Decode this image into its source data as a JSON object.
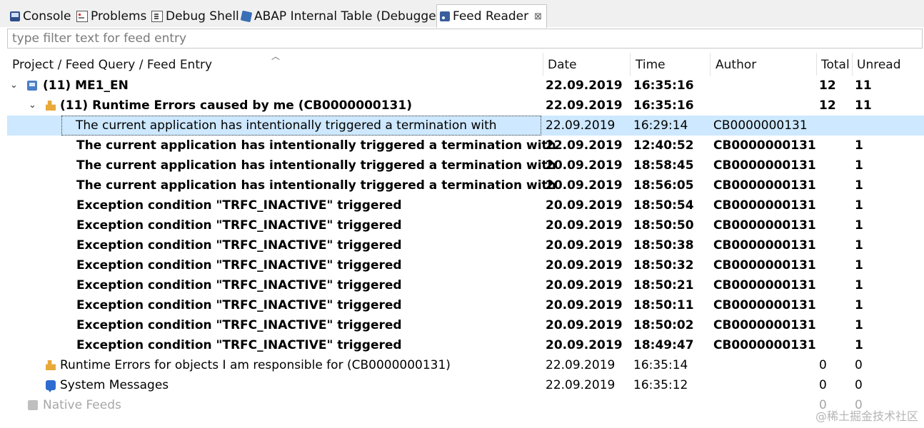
{
  "tabs": [
    {
      "label": "Console",
      "icon": "console-icon"
    },
    {
      "label": "Problems",
      "icon": "problems-icon"
    },
    {
      "label": "Debug Shell",
      "icon": "debug-shell-icon"
    },
    {
      "label": "ABAP Internal Table (Debugger)",
      "icon": "abap-table-icon"
    },
    {
      "label": "Feed Reader",
      "icon": "feed-reader-icon",
      "active": true,
      "close": "⊠"
    }
  ],
  "filter": {
    "placeholder": "type filter text for feed entry",
    "value": ""
  },
  "columns": {
    "entry": "Project / Feed Query / Feed Entry",
    "date": "Date",
    "time": "Time",
    "author": "Author",
    "total": "Total",
    "unread": "Unread"
  },
  "rows": [
    {
      "label": "(11) ME1_EN",
      "date": "22.09.2019",
      "time": "16:35:16",
      "author": "",
      "total": "12",
      "unread": "11",
      "bold": true
    },
    {
      "label": "(11) Runtime Errors caused by me (CB0000000131)",
      "date": "22.09.2019",
      "time": "16:35:16",
      "author": "",
      "total": "12",
      "unread": "11",
      "bold": true
    },
    {
      "label": "The current application has intentionally triggered a termination with",
      "date": "22.09.2019",
      "time": "16:29:14",
      "author": "CB0000000131",
      "total": "",
      "unread": "",
      "bold": false,
      "selected": true
    },
    {
      "label": "The current application has intentionally triggered a termination with",
      "date": "22.09.2019",
      "time": "12:40:52",
      "author": "CB0000000131",
      "total": "",
      "unread": "1",
      "bold": true
    },
    {
      "label": "The current application has intentionally triggered a termination with",
      "date": "20.09.2019",
      "time": "18:58:45",
      "author": "CB0000000131",
      "total": "",
      "unread": "1",
      "bold": true
    },
    {
      "label": "The current application has intentionally triggered a termination with",
      "date": "20.09.2019",
      "time": "18:56:05",
      "author": "CB0000000131",
      "total": "",
      "unread": "1",
      "bold": true
    },
    {
      "label": "Exception condition \"TRFC_INACTIVE\" triggered",
      "date": "20.09.2019",
      "time": "18:50:54",
      "author": "CB0000000131",
      "total": "",
      "unread": "1",
      "bold": true
    },
    {
      "label": "Exception condition \"TRFC_INACTIVE\" triggered",
      "date": "20.09.2019",
      "time": "18:50:50",
      "author": "CB0000000131",
      "total": "",
      "unread": "1",
      "bold": true
    },
    {
      "label": "Exception condition \"TRFC_INACTIVE\" triggered",
      "date": "20.09.2019",
      "time": "18:50:38",
      "author": "CB0000000131",
      "total": "",
      "unread": "1",
      "bold": true
    },
    {
      "label": "Exception condition \"TRFC_INACTIVE\" triggered",
      "date": "20.09.2019",
      "time": "18:50:32",
      "author": "CB0000000131",
      "total": "",
      "unread": "1",
      "bold": true
    },
    {
      "label": "Exception condition \"TRFC_INACTIVE\" triggered",
      "date": "20.09.2019",
      "time": "18:50:21",
      "author": "CB0000000131",
      "total": "",
      "unread": "1",
      "bold": true
    },
    {
      "label": "Exception condition \"TRFC_INACTIVE\" triggered",
      "date": "20.09.2019",
      "time": "18:50:11",
      "author": "CB0000000131",
      "total": "",
      "unread": "1",
      "bold": true
    },
    {
      "label": "Exception condition \"TRFC_INACTIVE\" triggered",
      "date": "20.09.2019",
      "time": "18:50:02",
      "author": "CB0000000131",
      "total": "",
      "unread": "1",
      "bold": true
    },
    {
      "label": "Exception condition \"TRFC_INACTIVE\" triggered",
      "date": "20.09.2019",
      "time": "18:49:47",
      "author": "CB0000000131",
      "total": "",
      "unread": "1",
      "bold": true
    },
    {
      "label": "Runtime Errors for objects I am responsible for (CB0000000131)",
      "date": "22.09.2019",
      "time": "16:35:14",
      "author": "",
      "total": "0",
      "unread": "0",
      "bold": false
    },
    {
      "label": "System Messages",
      "date": "22.09.2019",
      "time": "16:35:12",
      "author": "",
      "total": "0",
      "unread": "0",
      "bold": false
    },
    {
      "label": "Native Feeds",
      "date": "",
      "time": "",
      "author": "",
      "total": "0",
      "unread": "0",
      "bold": false,
      "disabled": true
    }
  ],
  "watermark": "@稀土掘金技术社区"
}
